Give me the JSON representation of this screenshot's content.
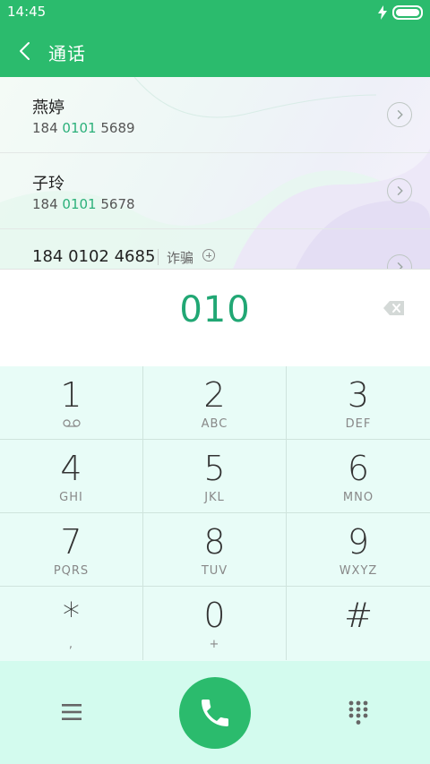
{
  "status": {
    "time": "14:45"
  },
  "header": {
    "title": "通话"
  },
  "results": [
    {
      "name": "燕婷",
      "num_prefix": "184 ",
      "num_match": "0101",
      "num_suffix": " 5689"
    },
    {
      "name": "子玲",
      "num_prefix": "184 ",
      "num_match": "0101",
      "num_suffix": " 5678"
    }
  ],
  "result3": {
    "number": "184 0102 4685",
    "tag": "诈骗"
  },
  "dialer": {
    "input": "010"
  },
  "keys": [
    {
      "digit": "1",
      "letters": ""
    },
    {
      "digit": "2",
      "letters": "ABC"
    },
    {
      "digit": "3",
      "letters": "DEF"
    },
    {
      "digit": "4",
      "letters": "GHI"
    },
    {
      "digit": "5",
      "letters": "JKL"
    },
    {
      "digit": "6",
      "letters": "MNO"
    },
    {
      "digit": "7",
      "letters": "PQRS"
    },
    {
      "digit": "8",
      "letters": "TUV"
    },
    {
      "digit": "9",
      "letters": "WXYZ"
    },
    {
      "digit": "*",
      "letters": ","
    },
    {
      "digit": "0",
      "letters": "+"
    },
    {
      "digit": "#",
      "letters": ""
    }
  ],
  "icons": {
    "back": "chevron-left-icon",
    "voicemail": "voicemail-icon",
    "backspace": "backspace-icon",
    "menu": "menu-icon",
    "call": "phone-icon",
    "keypad": "dialpad-icon"
  },
  "colors": {
    "primary": "#2bbb6d",
    "highlight": "#21a774",
    "keypad_bg": "#e8fcf7",
    "bottom_bg": "#d3fbee"
  }
}
